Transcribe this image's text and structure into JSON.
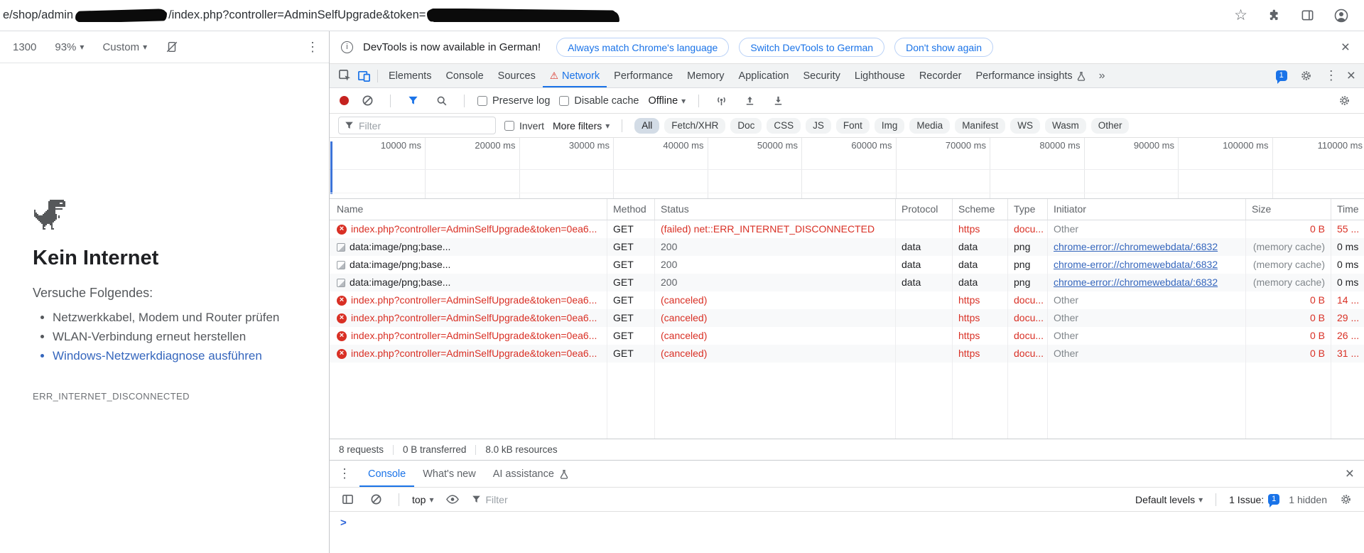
{
  "colors": {
    "accent": "#1a73e8",
    "error": "#d93025",
    "link": "#3566bd",
    "text": "#202124",
    "muted": "#5f6368",
    "faint": "#80868b",
    "border": "#e0e0e0",
    "toolbar-bg": "#f1f3f4"
  },
  "browser": {
    "url_before_redaction": "e/shop/admin",
    "url_after_redaction": "/index.php?controller=AdminSelfUpgrade&token="
  },
  "device_toolbar": {
    "dimension": "1300",
    "zoom": "93%",
    "preset": "Custom"
  },
  "error_page": {
    "title": "Kein Internet",
    "subtitle": "Versuche Folgendes:",
    "suggestions": [
      {
        "text": "Netzwerkkabel, Modem und Router prüfen",
        "type": "plain"
      },
      {
        "text": "WLAN-Verbindung erneut herstellen",
        "type": "plain"
      },
      {
        "text": "Windows-Netzwerkdiagnose ausführen",
        "type": "link"
      }
    ],
    "error_code": "ERR_INTERNET_DISCONNECTED"
  },
  "devtools": {
    "notification": {
      "message": "DevTools is now available in German!",
      "actions": [
        "Always match Chrome's language",
        "Switch DevTools to German",
        "Don't show again"
      ]
    },
    "tabs": {
      "elements": "Elements",
      "console": "Console",
      "sources": "Sources",
      "network": "Network",
      "performance": "Performance",
      "memory": "Memory",
      "application": "Application",
      "security": "Security",
      "lighthouse": "Lighthouse",
      "recorder": "Recorder",
      "performance_insights": "Performance insights"
    },
    "messages_badge": "1",
    "network_toolbar": {
      "preserve_log": "Preserve log",
      "disable_cache": "Disable cache",
      "throttling": "Offline"
    },
    "filter_bar": {
      "placeholder": "Filter",
      "invert": "Invert",
      "more_filters": "More filters",
      "chips": [
        {
          "label": "All",
          "state": "selected"
        },
        {
          "label": "Fetch/XHR",
          "state": ""
        },
        {
          "label": "Doc",
          "state": ""
        },
        {
          "label": "CSS",
          "state": ""
        },
        {
          "label": "JS",
          "state": ""
        },
        {
          "label": "Font",
          "state": ""
        },
        {
          "label": "Img",
          "state": ""
        },
        {
          "label": "Media",
          "state": ""
        },
        {
          "label": "Manifest",
          "state": ""
        },
        {
          "label": "WS",
          "state": ""
        },
        {
          "label": "Wasm",
          "state": ""
        },
        {
          "label": "Other",
          "state": ""
        }
      ]
    },
    "timeline_ticks": [
      "10000 ms",
      "20000 ms",
      "30000 ms",
      "40000 ms",
      "50000 ms",
      "60000 ms",
      "70000 ms",
      "80000 ms",
      "90000 ms",
      "100000 ms",
      "110000 ms"
    ],
    "table": {
      "columns": {
        "name": "Name",
        "method": "Method",
        "status": "Status",
        "protocol": "Protocol",
        "scheme": "Scheme",
        "type": "Type",
        "initiator": "Initiator",
        "size": "Size",
        "time": "Time"
      },
      "rows": [
        {
          "state": "error",
          "icon": "error-icon",
          "name": "index.php?controller=AdminSelfUpgrade&token=0ea6...",
          "method": "GET",
          "status": "(failed) net::ERR_INTERNET_DISCONNECTED",
          "protocol": "",
          "scheme": "https",
          "type": "docu...",
          "initiator": "Other",
          "initiator_class": "plain",
          "size": "0 B",
          "size_class": "",
          "time": "55 ..."
        },
        {
          "state": "ok",
          "icon": "image-icon",
          "name": "data:image/png;base...",
          "method": "GET",
          "status": "200",
          "protocol": "data",
          "scheme": "data",
          "type": "png",
          "initiator": "chrome-error://chromewebdata/:6832",
          "initiator_class": "link",
          "size": "(memory cache)",
          "size_class": "muted",
          "time": "0 ms"
        },
        {
          "state": "ok",
          "icon": "image-icon",
          "name": "data:image/png;base...",
          "method": "GET",
          "status": "200",
          "protocol": "data",
          "scheme": "data",
          "type": "png",
          "initiator": "chrome-error://chromewebdata/:6832",
          "initiator_class": "link",
          "size": "(memory cache)",
          "size_class": "muted",
          "time": "0 ms"
        },
        {
          "state": "ok",
          "icon": "image-icon",
          "name": "data:image/png;base...",
          "method": "GET",
          "status": "200",
          "protocol": "data",
          "scheme": "data",
          "type": "png",
          "initiator": "chrome-error://chromewebdata/:6832",
          "initiator_class": "link",
          "size": "(memory cache)",
          "size_class": "muted",
          "time": "0 ms"
        },
        {
          "state": "error",
          "icon": "error-icon",
          "name": "index.php?controller=AdminSelfUpgrade&token=0ea6...",
          "method": "GET",
          "status": "(canceled)",
          "protocol": "",
          "scheme": "https",
          "type": "docu...",
          "initiator": "Other",
          "initiator_class": "plain",
          "size": "0 B",
          "size_class": "",
          "time": "14 ..."
        },
        {
          "state": "error",
          "icon": "error-icon",
          "name": "index.php?controller=AdminSelfUpgrade&token=0ea6...",
          "method": "GET",
          "status": "(canceled)",
          "protocol": "",
          "scheme": "https",
          "type": "docu...",
          "initiator": "Other",
          "initiator_class": "plain",
          "size": "0 B",
          "size_class": "",
          "time": "29 ..."
        },
        {
          "state": "error",
          "icon": "error-icon",
          "name": "index.php?controller=AdminSelfUpgrade&token=0ea6...",
          "method": "GET",
          "status": "(canceled)",
          "protocol": "",
          "scheme": "https",
          "type": "docu...",
          "initiator": "Other",
          "initiator_class": "plain",
          "size": "0 B",
          "size_class": "",
          "time": "26 ..."
        },
        {
          "state": "error",
          "icon": "error-icon",
          "name": "index.php?controller=AdminSelfUpgrade&token=0ea6...",
          "method": "GET",
          "status": "(canceled)",
          "protocol": "",
          "scheme": "https",
          "type": "docu...",
          "initiator": "Other",
          "initiator_class": "plain",
          "size": "0 B",
          "size_class": "",
          "time": "31 ..."
        }
      ]
    },
    "summary": [
      "8 requests",
      "0 B transferred",
      "8.0 kB resources"
    ],
    "drawer": {
      "tabs": {
        "console": "Console",
        "whats_new": "What's new",
        "ai": "AI assistance"
      },
      "context": "top",
      "filter_placeholder": "Filter",
      "levels": "Default levels",
      "issues_label": "1 Issue:",
      "issues_count": "1",
      "hidden": "1 hidden"
    }
  }
}
